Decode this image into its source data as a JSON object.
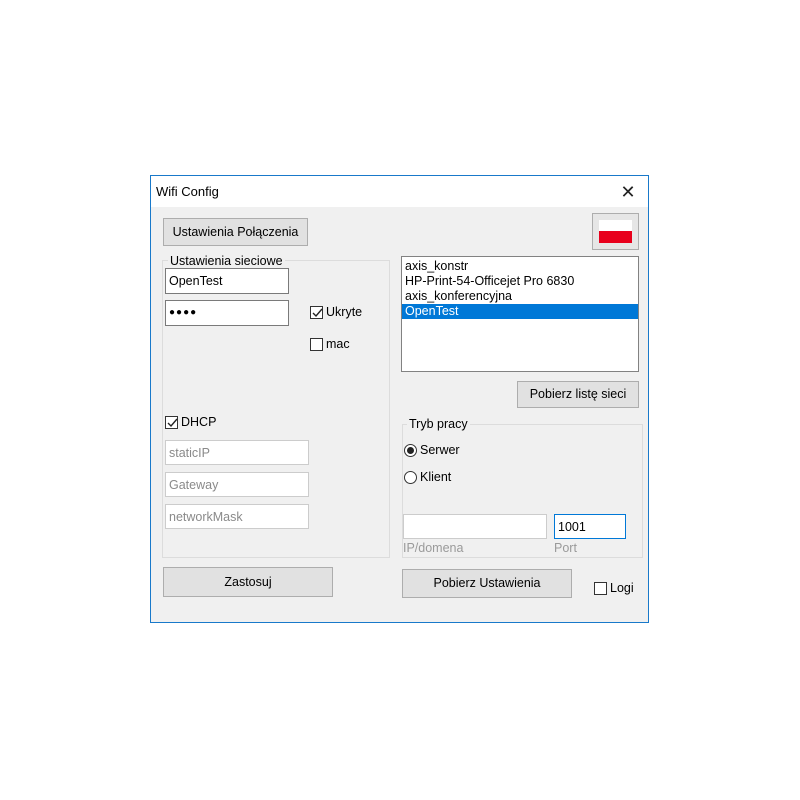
{
  "window": {
    "title": "Wifi Config",
    "close_icon": "close-icon"
  },
  "buttons": {
    "connection_settings": "Ustawienia Połączenia",
    "fetch_networks": "Pobierz listę sieci",
    "apply": "Zastosuj",
    "fetch_settings": "Pobierz Ustawienia"
  },
  "language_flag": {
    "icon": "poland-flag-icon",
    "colors": {
      "top": "#ffffff",
      "bottom": "#e8001c"
    }
  },
  "network_group": {
    "legend": "Ustawienia sieciowe",
    "ssid_value": "OpenTest",
    "password_mask": "●●●●",
    "hidden_label": "Ukryte",
    "hidden_checked": true,
    "mac_label": "mac",
    "mac_checked": false,
    "dhcp_label": "DHCP",
    "dhcp_checked": true,
    "static_ip_placeholder": "staticIP",
    "gateway_placeholder": "Gateway",
    "netmask_placeholder": "networkMask"
  },
  "network_list": {
    "items": [
      "axis_konstr",
      "HP-Print-54-Officejet Pro 6830",
      "axis_konferencyjna",
      "OpenTest"
    ],
    "selected_index": 3
  },
  "mode_group": {
    "legend": "Tryb pracy",
    "server_label": "Serwer",
    "client_label": "Klient",
    "selected": "Serwer",
    "ip_label": "IP/domena",
    "ip_value": "",
    "port_label": "Port",
    "port_value": "1001"
  },
  "logs": {
    "label": "Logi",
    "checked": false
  },
  "colors": {
    "accent": "#0078d7",
    "window_border": "#1979ca",
    "background": "#f0f0f0"
  }
}
